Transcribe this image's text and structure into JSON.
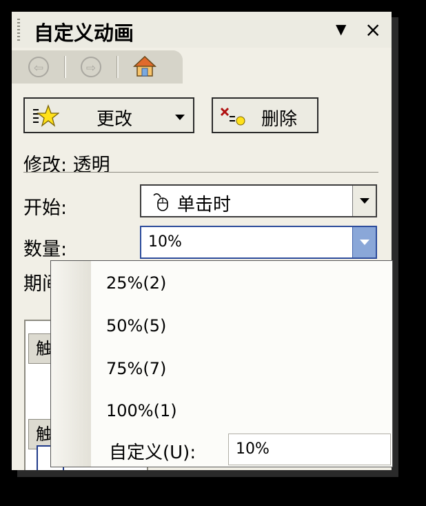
{
  "panel": {
    "title": "自定义动画",
    "menu_glyph": "▼",
    "close_glyph": "×"
  },
  "nav": {
    "back_glyph": "⇦",
    "forward_glyph": "⇨"
  },
  "toolbar": {
    "change_label": "更改",
    "delete_label": "删除"
  },
  "modify": {
    "text": "修改: 透明"
  },
  "start": {
    "label": "开始:",
    "value": "单击时"
  },
  "quantity": {
    "label": "数量:",
    "value": "10%"
  },
  "period": {
    "label": "期间:"
  },
  "list": {
    "item_prefix": "触"
  },
  "dropdown": {
    "options": [
      "25%(2)",
      "50%(5)",
      "75%(7)",
      "100%(1)"
    ],
    "custom_label": "自定义(U):",
    "custom_value": "10%"
  },
  "colors": {
    "panel_bg": "#f1efe6",
    "accent_blue": "#2b4b9b",
    "combo_button_blue": "#8aa7d8"
  }
}
